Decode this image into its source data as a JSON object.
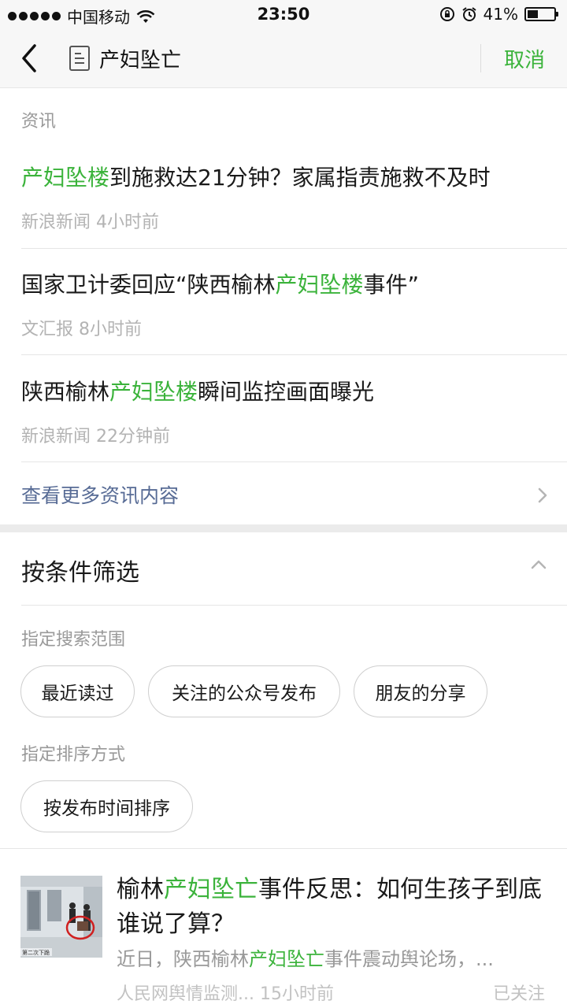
{
  "status_bar": {
    "carrier": "中国移动",
    "time": "23:50",
    "battery": "41%",
    "battery_level": 0.41
  },
  "header": {
    "query": "产妇坠亡",
    "cancel_label": "取消",
    "icons": [
      "back-arrow-icon",
      "document-icon"
    ]
  },
  "news": {
    "section_label": "资讯",
    "items": [
      {
        "pre": "",
        "hl": "产妇坠楼",
        "post": "到施救达21分钟？家属指责施救不及时",
        "meta": "新浪新闻 4小时前"
      },
      {
        "pre": "国家卫计委回应“陕西榆林",
        "hl": "产妇坠楼",
        "post": "事件”",
        "meta": "文汇报 8小时前"
      },
      {
        "pre": "陕西榆林",
        "hl": "产妇坠楼",
        "post": "瞬间监控画面曝光",
        "meta": "新浪新闻 22分钟前"
      }
    ],
    "more_label": "查看更多资讯内容"
  },
  "filter": {
    "title": "按条件筛选",
    "scope_label": "指定搜索范围",
    "scope_options": [
      "最近读过",
      "关注的公众号发布",
      "朋友的分享"
    ],
    "sort_label": "指定排序方式",
    "sort_options": [
      "按发布时间排序"
    ]
  },
  "article": {
    "title_pre": "榆林",
    "title_hl": "产妇坠亡",
    "title_post": "事件反思：如何生孩子到底谁说了算？",
    "desc_pre": "近日，陕西榆林",
    "desc_hl": "产妇坠亡",
    "desc_post": "事件震动舆论场，...",
    "meta": "人民网舆情监测... 15小时前",
    "follow_status": "已关注",
    "thumb_caption": "第二次下跪"
  },
  "colors": {
    "accent_green": "#3bb33b",
    "link_blue": "#576b95"
  }
}
